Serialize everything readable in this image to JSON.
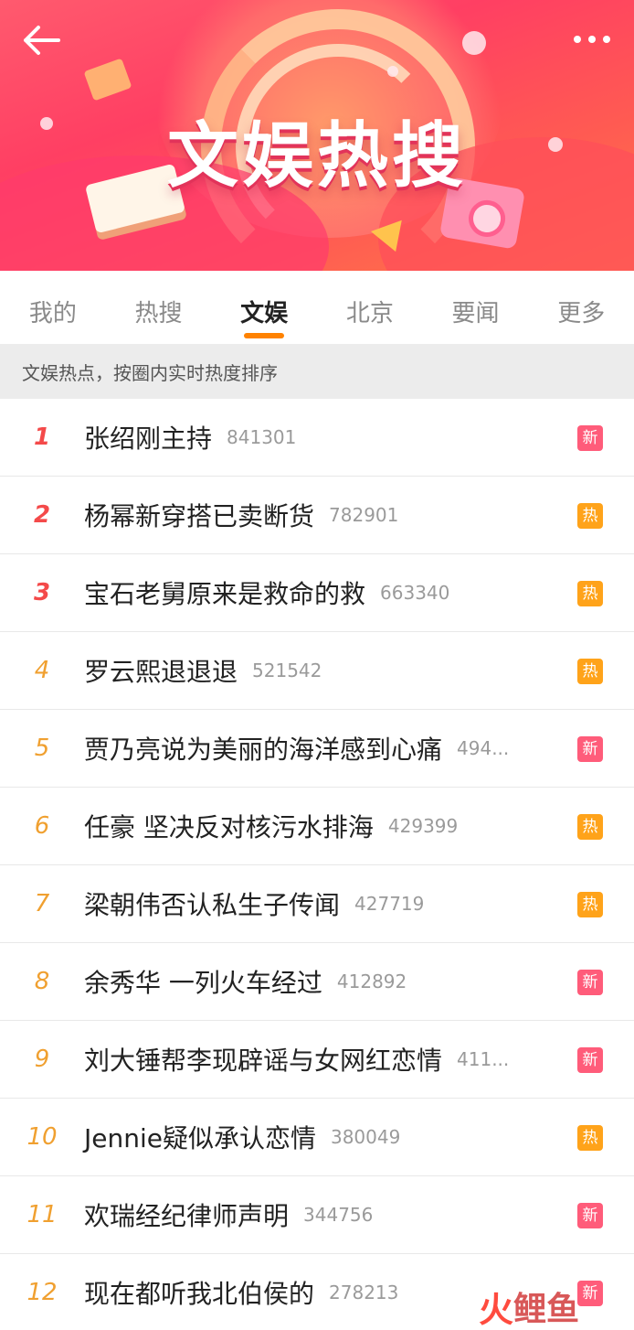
{
  "header": {
    "banner_title": "文娱热搜",
    "back_icon": "back-arrow-icon",
    "more_icon": "more-dots-icon"
  },
  "tabs": [
    {
      "label": "我的"
    },
    {
      "label": "热搜"
    },
    {
      "label": "文娱",
      "active": true
    },
    {
      "label": "北京"
    },
    {
      "label": "要闻"
    },
    {
      "label": "更多"
    }
  ],
  "subheader": "文娱热点，按圈内实时热度排序",
  "colors": {
    "accent": "#ff8200",
    "rank_top": "#f44a4a",
    "rank_other": "#f0a030",
    "badge_new": "#ff5c7a",
    "badge_hot": "#ffa31a"
  },
  "items": [
    {
      "rank": "1",
      "title": "张绍刚主持",
      "count": "841301",
      "badge": "新",
      "badge_type": "new"
    },
    {
      "rank": "2",
      "title": "杨幂新穿搭已卖断货",
      "count": "782901",
      "badge": "热",
      "badge_type": "hot"
    },
    {
      "rank": "3",
      "title": "宝石老舅原来是救命的救",
      "count": "663340",
      "badge": "热",
      "badge_type": "hot"
    },
    {
      "rank": "4",
      "title": "罗云熙退退退",
      "count": "521542",
      "badge": "热",
      "badge_type": "hot"
    },
    {
      "rank": "5",
      "title": "贾乃亮说为美丽的海洋感到心痛",
      "count": "494...",
      "badge": "新",
      "badge_type": "new"
    },
    {
      "rank": "6",
      "title": "任豪 坚决反对核污水排海",
      "count": "429399",
      "badge": "热",
      "badge_type": "hot"
    },
    {
      "rank": "7",
      "title": "梁朝伟否认私生子传闻",
      "count": "427719",
      "badge": "热",
      "badge_type": "hot"
    },
    {
      "rank": "8",
      "title": "余秀华 一列火车经过",
      "count": "412892",
      "badge": "新",
      "badge_type": "new"
    },
    {
      "rank": "9",
      "title": "刘大锤帮李现辟谣与女网红恋情",
      "count": "411...",
      "badge": "新",
      "badge_type": "new"
    },
    {
      "rank": "10",
      "title": "Jennie疑似承认恋情",
      "count": "380049",
      "badge": "热",
      "badge_type": "hot"
    },
    {
      "rank": "11",
      "title": "欢瑞经纪律师声明",
      "count": "344756",
      "badge": "新",
      "badge_type": "new"
    },
    {
      "rank": "12",
      "title": "现在都听我北伯侯的",
      "count": "278213",
      "badge": "新",
      "badge_type": "new"
    }
  ],
  "watermark": {
    "icon": "火",
    "text": "鲤鱼"
  }
}
